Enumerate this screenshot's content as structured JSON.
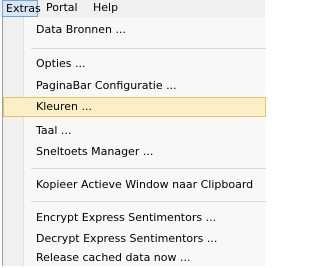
{
  "menubar": {
    "items": [
      {
        "label": "Extras",
        "active": true
      },
      {
        "label": "Portal"
      },
      {
        "label": "Help"
      }
    ]
  },
  "menu": {
    "items": [
      {
        "label": "Data Bronnen ..."
      },
      {
        "label": "Opties ..."
      },
      {
        "label": "PaginaBar Configuratie ..."
      },
      {
        "label": "Kleuren ...",
        "highlighted": true
      },
      {
        "label": "Taal ..."
      },
      {
        "label": "Sneltoets Manager ..."
      },
      {
        "label": "Kopieer Actieve Window naar Clipboard"
      },
      {
        "label": "Encrypt Express Sentimentors ..."
      },
      {
        "label": "Decrypt Express Sentimentors ..."
      },
      {
        "label": "Release cached data now ..."
      }
    ]
  },
  "colors": {
    "highlight_bg": "#fcefc6",
    "highlight_border": "#e5c365",
    "menubar_active_bg": "#d6e5f5"
  }
}
